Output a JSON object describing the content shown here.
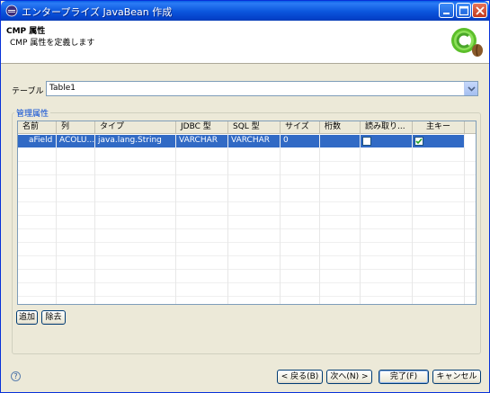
{
  "window": {
    "title": "エンタープライズ JavaBean 作成"
  },
  "header": {
    "title": "CMP 属性",
    "description": "CMP 属性を定義します"
  },
  "table_field": {
    "label": "テーブル :",
    "value": "Table1"
  },
  "group": {
    "label": "管理属性"
  },
  "grid": {
    "columns": [
      "名前",
      "列",
      "タイプ",
      "JDBC 型",
      "SQL 型",
      "サイズ",
      "桁数",
      "読み取り...",
      "主キー"
    ],
    "rows": [
      {
        "name": "aField",
        "column": "ACOLU...",
        "type": "java.lang.String",
        "jdbc_type": "VARCHAR",
        "sql_type": "VARCHAR",
        "size": "0",
        "scale": "",
        "read_only": false,
        "primary_key": true
      }
    ]
  },
  "buttons": {
    "add": "追加",
    "remove": "除去",
    "back": "< 戻る(B)",
    "next": "次へ(N) >",
    "finish": "完了(F)",
    "cancel": "キャンセル"
  },
  "icons": {
    "title": "eclipse-icon",
    "help": "help-icon",
    "logo": "cmp-bean-logo-icon"
  },
  "colors": {
    "selection": "#316ac5",
    "titlebar": "#0b55dc",
    "group_label": "#0046d5"
  }
}
